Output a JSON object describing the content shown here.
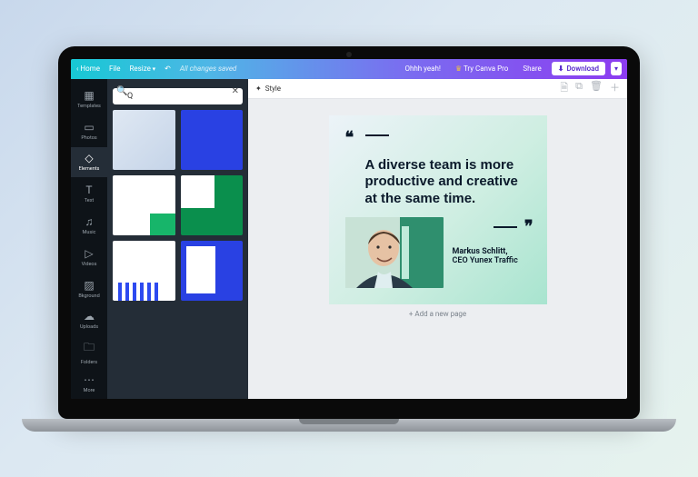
{
  "topbar": {
    "home": "Home",
    "file": "File",
    "resize": "Resize",
    "status": "All changes saved",
    "ohhh": "Ohhh yeah!",
    "try_pro": "Try Canva Pro",
    "share": "Share",
    "download": "Download"
  },
  "rail": {
    "items": [
      {
        "id": "templates",
        "label": "Templates",
        "icon": "▦"
      },
      {
        "id": "photos",
        "label": "Photos",
        "icon": "▭"
      },
      {
        "id": "elements",
        "label": "Elements",
        "icon": "◇"
      },
      {
        "id": "text",
        "label": "Text",
        "icon": "T"
      },
      {
        "id": "music",
        "label": "Music",
        "icon": "♫"
      },
      {
        "id": "videos",
        "label": "Videos",
        "icon": "▷"
      },
      {
        "id": "background",
        "label": "Bkground",
        "icon": "▨"
      },
      {
        "id": "uploads",
        "label": "Uploads",
        "icon": "☁"
      },
      {
        "id": "folders",
        "label": "Folders",
        "icon": "🗀"
      },
      {
        "id": "more",
        "label": "More",
        "icon": "⋯"
      }
    ],
    "active": "elements"
  },
  "search": {
    "value": "Q",
    "placeholder": "Search"
  },
  "context_bar": {
    "style": "Style"
  },
  "canvas": {
    "quote": "A diverse team is more productive and creative at the same time.",
    "attr_name": "Markus Schlitt,",
    "attr_title": "CEO Yunex Traffic"
  },
  "stage": {
    "add_page": "+ Add a new page"
  }
}
